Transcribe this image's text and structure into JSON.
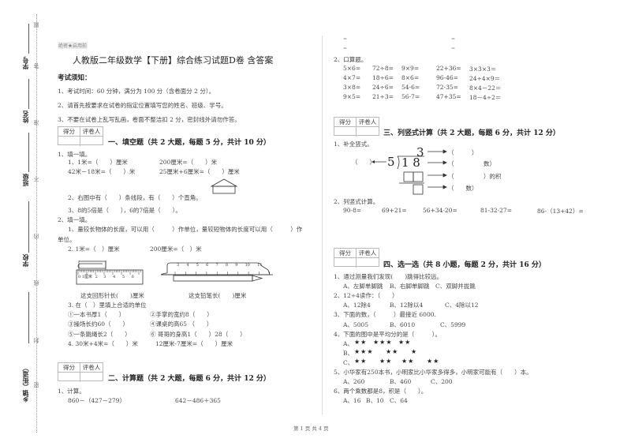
{
  "margin": {
    "labels": [
      "学号",
      "姓名",
      "班级",
      "学校",
      "乡镇（街道）"
    ],
    "seal_chars": [
      "题",
      "答",
      "准",
      "不",
      "内",
      "线",
      "封",
      "密"
    ]
  },
  "header": {
    "secret_mark": "绝密★启用前",
    "title": "人教版二年级数学【下册】综合练习试题D卷 含答案"
  },
  "notice": {
    "heading": "考试须知：",
    "items": [
      "1、考试时间：60 分钟，满分为 100 分（含卷面分 2 分）。",
      "2、请首先按要求在试卷的指定位置填写您的姓名、班级、学号。",
      "3、不要在试卷上乱写乱画，卷面不整洁扣 2 分，密封线外请勿作答。"
    ]
  },
  "score_box": {
    "score": "得分",
    "grader": "评卷人"
  },
  "section1": {
    "title": "一、填空题（共 2 大题，每题 5 分，共计 10 分）",
    "q1": "1、填一填。",
    "q1_1a": "1、1米=（　　）厘米",
    "q1_1b": "200厘米=（　　）米",
    "q1_1c": "42米－18米=（　　）米",
    "q1_1d": "25厘米+6厘米=（　　）厘米",
    "q1_2": "2、右图中有（　　）条线段，有（　　）个直角。",
    "q1_3": "3、8的5倍是（　　），6的7倍是（　　）。",
    "q2": "2、填一填。",
    "q2_1a": "1、量较长物体的长度，可以用（　　　）作单位，量较短物体的长度可以用（　　　）作",
    "q2_1b": "单位。",
    "q2_2a": "2. 1米=（　）厘米",
    "q2_2b": "200厘米=（　）米",
    "clip_caption": "这支回形针长(　　)厘米",
    "pencil_caption": "这支铅笔长(　　)厘米",
    "ruler1_ticks": [
      "0",
      "1厘米",
      "2",
      "3",
      "4",
      "5",
      "6"
    ],
    "ruler2_ticks": [
      "3",
      "4",
      "5",
      "6",
      "7",
      "8",
      "9",
      "10",
      "11"
    ],
    "q2_3": "3. 在（　）里填上合适的单位",
    "units": [
      [
        "①一本书厚1（　　）",
        "②手掌的宽约8（　　）"
      ],
      [
        "③操场长约60（　　）",
        "④课桌的高65 （　　）"
      ],
      [
        "⑤一条跳绳长2（　　）",
        "⑥ 哥哥的身高1（　　）28（　　）"
      ]
    ],
    "q2_4a": "4. 30米+4米=（　　）米",
    "q2_4b": "12厘米-7厘米=（　　）厘米"
  },
  "section2": {
    "title": "二、计算题（共 2 大题，每题 6 分，共计 12 分）",
    "q1": "1、计算。",
    "expr1": "860－（427－279）",
    "expr2": "642－486＋365",
    "cont_marks": [
      "=",
      "=",
      "=",
      "="
    ],
    "q2": "2、口算题。",
    "oral": [
      [
        "5×6=",
        "72÷8=",
        "9×9=",
        "22+36=",
        "3×3×3＝"
      ],
      [
        "4×7=",
        "18÷6=",
        "8×6=",
        "96-46=",
        "24÷4×9＝"
      ],
      [
        "3×8=",
        "24÷6=",
        "54-6=",
        "72-35=",
        "8×4－22＝"
      ],
      [
        "9×5=",
        "21÷3=",
        "56-7=",
        "47+35=",
        "18－4÷2＝"
      ]
    ]
  },
  "section3": {
    "title": "三、列竖式计算（共 2 大题，每题 6 分，共计 12 分）",
    "q1": "1、补全竖式。",
    "quotient": "3",
    "divisor": "5",
    "dividend": "1 8",
    "left_blank": "（　　）",
    "labels": [
      "（　　　）",
      "（　　　　　数）",
      "（　　　　　）的积",
      "（　　数）"
    ],
    "q2": "2、列竖式计算。",
    "exprs": [
      "90-8=",
      "69+21=",
      "56+34-20=",
      "81-32-27=",
      "86-（13+42）="
    ]
  },
  "section4": {
    "title": "四、选一选（共 8 小题，每题 2 分，共计 16 分）",
    "questions": [
      {
        "q": "1、通过测量我们发现(　　)跳得比较远。",
        "opts": [
          "A、左脚单脚跳",
          "B、右脚单脚跳",
          "C、双脚并拢跳"
        ]
      },
      {
        "q": "2、12÷4读作：（　　）",
        "opts": [
          "A、12除4",
          "B、12除以4",
          "C、4除以12"
        ]
      },
      {
        "q": "3、下面的数，（　　　）最接近 6000.",
        "opts": [
          "A、5005",
          "B、6010",
          "C、5999"
        ]
      }
    ],
    "q4": "4、下面的图中是平均分的是（　　　）。",
    "q4_opts": [
      {
        "label": "A、",
        "groups": [
          "★★",
          "★★★",
          "★★"
        ]
      },
      {
        "label": "B、",
        "groups": [
          "★★★",
          "★★",
          "★"
        ]
      },
      {
        "label": "C、",
        "groups": [
          "★★",
          "★★",
          "★★",
          "★★"
        ]
      }
    ],
    "q5": "5、小华家有250本书，小明家比小华家多得多，小明家可能有（　　）本。",
    "q5_opts": [
      "A、260",
      "B、460",
      "C、200"
    ],
    "q6": "6、两个乘数都是8，积是（　　）。",
    "q6_opts": [
      "A、16",
      "B、10",
      "C、64"
    ]
  },
  "footer": {
    "page": "第 1 页 共 4 页"
  }
}
